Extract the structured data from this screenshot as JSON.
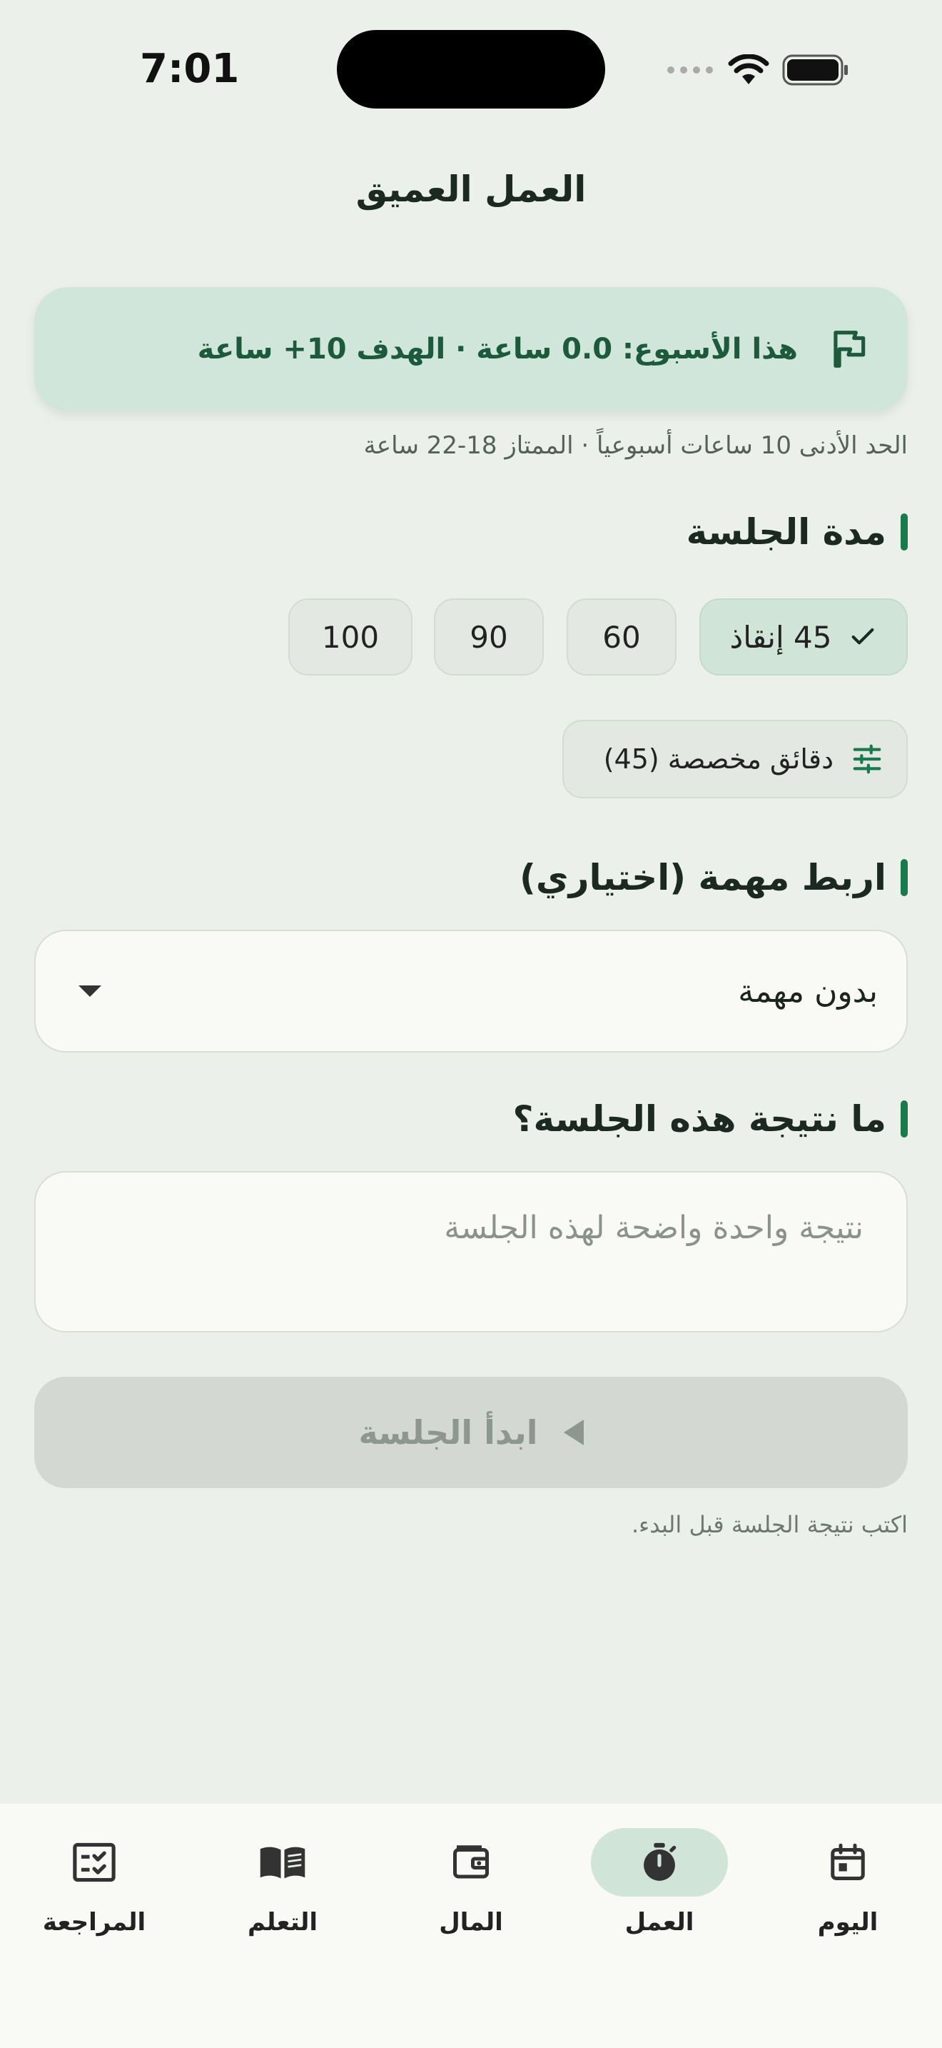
{
  "status": {
    "time": "7:01"
  },
  "header": {
    "title": "العمل العميق"
  },
  "week": {
    "summary": "هذا الأسبوع: 0.0 ساعة · الهدف 10+ ساعة",
    "note": "الحد الأدنى 10 ساعات أسبوعياً · الممتاز 18-22 ساعة"
  },
  "duration": {
    "heading": "مدة الجلسة",
    "options": [
      "45 إنقاذ",
      "60",
      "90",
      "100"
    ],
    "selected": "45 إنقاذ",
    "custom_label": "دقائق مخصصة (45)"
  },
  "task": {
    "heading": "اربط مهمة (اختياري)",
    "value": "بدون مهمة"
  },
  "outcome": {
    "heading": "ما نتيجة هذه الجلسة؟",
    "placeholder": "نتيجة واحدة واضحة لهذه الجلسة",
    "value": ""
  },
  "start": {
    "label": "ابدأ الجلسة",
    "hint": "اكتب نتيجة الجلسة قبل البدء."
  },
  "nav": {
    "items": [
      {
        "label": "اليوم",
        "icon": "calendar-icon"
      },
      {
        "label": "العمل",
        "icon": "timer-icon"
      },
      {
        "label": "المال",
        "icon": "wallet-icon"
      },
      {
        "label": "التعلم",
        "icon": "book-icon"
      },
      {
        "label": "المراجعة",
        "icon": "checklist-icon"
      }
    ],
    "active": "العمل"
  },
  "colors": {
    "accent": "#1b7a4d",
    "accent_soft": "#d0e4d8",
    "background": "#ecf0ea"
  }
}
